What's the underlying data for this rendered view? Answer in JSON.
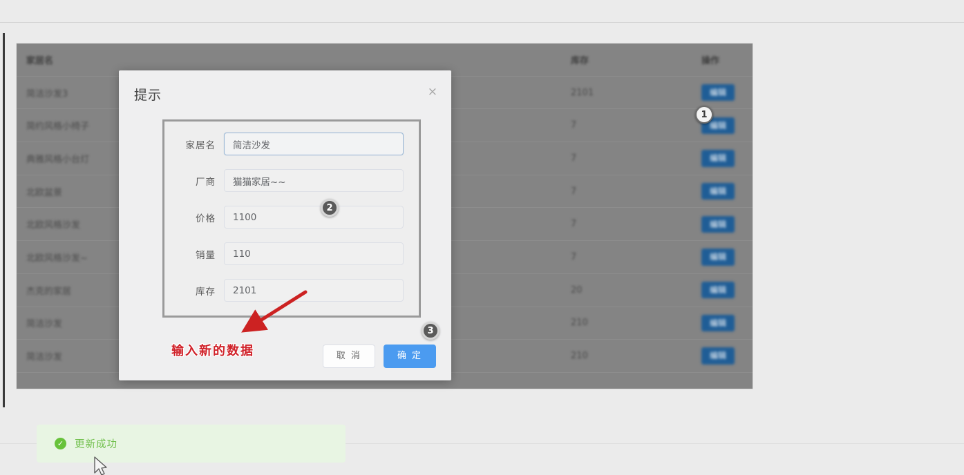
{
  "table": {
    "columns": [
      "家居名",
      "库存",
      "操作"
    ],
    "action_label": "编辑",
    "rows": [
      {
        "name": "简洁沙发3",
        "stock": "2101"
      },
      {
        "name": "简约风格小椅子",
        "stock": "7"
      },
      {
        "name": "典雅风格小台灯",
        "stock": "7"
      },
      {
        "name": "北欧盆景",
        "stock": "7"
      },
      {
        "name": "北欧风格沙发",
        "stock": "7"
      },
      {
        "name": "北欧风格沙发~",
        "stock": "7"
      },
      {
        "name": "杰克的家居",
        "stock": "20"
      },
      {
        "name": "简洁沙发",
        "stock": "210"
      },
      {
        "name": "简洁沙发",
        "stock": "210"
      }
    ]
  },
  "dialog": {
    "title": "提示",
    "close_icon": "close-icon",
    "fields": [
      {
        "label": "家居名",
        "value": "简洁沙发",
        "focused": true
      },
      {
        "label": "厂商",
        "value": "猫猫家居~~",
        "focused": false
      },
      {
        "label": "价格",
        "value": "1100",
        "focused": false
      },
      {
        "label": "销量",
        "value": "110",
        "focused": false
      },
      {
        "label": "库存",
        "value": "2101",
        "focused": false
      }
    ],
    "cancel_label": "取 消",
    "confirm_label": "确 定"
  },
  "annotations": {
    "badge1": "1",
    "badge2": "2",
    "badge3": "3",
    "callout_text": "输入新的数据",
    "callout_color": "#d0222a"
  },
  "toast": {
    "icon": "success-check-icon",
    "message": "更新成功",
    "color": "#67c23a"
  },
  "colors": {
    "primary_button": "#4b9bf0",
    "table_edit_button": "#1f5d96",
    "overlay": "#848484",
    "page_bg": "#ebebeb"
  }
}
